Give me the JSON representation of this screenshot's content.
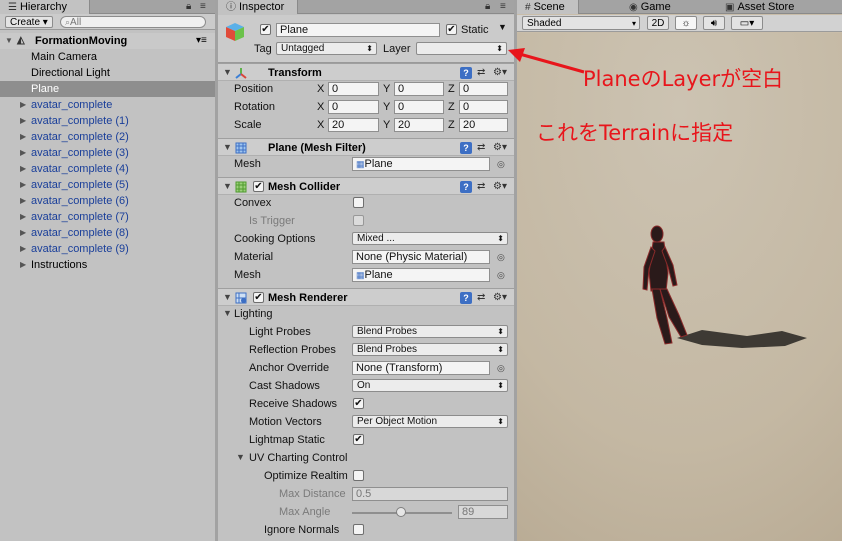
{
  "hierarchy": {
    "tab": "Hierarchy",
    "create_label": "Create",
    "search_placeholder": "All",
    "root": "FormationMoving",
    "items": [
      {
        "label": "Main Camera"
      },
      {
        "label": "Directional Light"
      },
      {
        "label": "Plane"
      },
      {
        "label": "avatar_complete"
      },
      {
        "label": "avatar_complete (1)"
      },
      {
        "label": "avatar_complete (2)"
      },
      {
        "label": "avatar_complete (3)"
      },
      {
        "label": "avatar_complete (4)"
      },
      {
        "label": "avatar_complete (5)"
      },
      {
        "label": "avatar_complete (6)"
      },
      {
        "label": "avatar_complete (7)"
      },
      {
        "label": "avatar_complete (8)"
      },
      {
        "label": "avatar_complete (9)"
      },
      {
        "label": "Instructions"
      }
    ]
  },
  "inspector": {
    "tab": "Inspector",
    "object_name": "Plane",
    "static_label": "Static",
    "tag_label": "Tag",
    "tag_value": "Untagged",
    "layer_label": "Layer",
    "layer_value": "",
    "transform": {
      "title": "Transform",
      "position_label": "Position",
      "rotation_label": "Rotation",
      "scale_label": "Scale",
      "x": "X",
      "y": "Y",
      "z": "Z",
      "position": [
        "0",
        "0",
        "0"
      ],
      "rotation": [
        "0",
        "0",
        "0"
      ],
      "scale": [
        "20",
        "20",
        "20"
      ]
    },
    "mesh_filter": {
      "title": "Plane (Mesh Filter)",
      "mesh_label": "Mesh",
      "mesh_value": "Plane"
    },
    "mesh_collider": {
      "title": "Mesh Collider",
      "convex_label": "Convex",
      "is_trigger_label": "Is Trigger",
      "cooking_label": "Cooking Options",
      "cooking_value": "Mixed ...",
      "material_label": "Material",
      "material_value": "None (Physic Material)",
      "mesh_label": "Mesh",
      "mesh_value": "Plane"
    },
    "mesh_renderer": {
      "title": "Mesh Renderer",
      "lighting_label": "Lighting",
      "light_probes_label": "Light Probes",
      "light_probes_value": "Blend Probes",
      "reflection_probes_label": "Reflection Probes",
      "reflection_probes_value": "Blend Probes",
      "anchor_override_label": "Anchor Override",
      "anchor_override_value": "None (Transform)",
      "cast_shadows_label": "Cast Shadows",
      "cast_shadows_value": "On",
      "receive_shadows_label": "Receive Shadows",
      "motion_vectors_label": "Motion Vectors",
      "motion_vectors_value": "Per Object Motion",
      "lightmap_static_label": "Lightmap Static",
      "uv_charting_label": "UV Charting Control",
      "optimize_label": "Optimize Realtim",
      "max_distance_label": "Max Distance",
      "max_distance_value": "0.5",
      "max_angle_label": "Max Angle",
      "max_angle_value": "89",
      "max_angle_slider_fraction": 0.49,
      "ignore_normals_label": "Ignore Normals"
    }
  },
  "scene": {
    "tab_scene": "Scene",
    "tab_game": "Game",
    "tab_asset_store": "Asset Store",
    "shading_mode": "Shaded",
    "btn_2d": "2D"
  },
  "annotations": {
    "line1": "PlaneのLayerが空白",
    "line2": "これをTerrainに指定",
    "color": "#e8151b"
  }
}
